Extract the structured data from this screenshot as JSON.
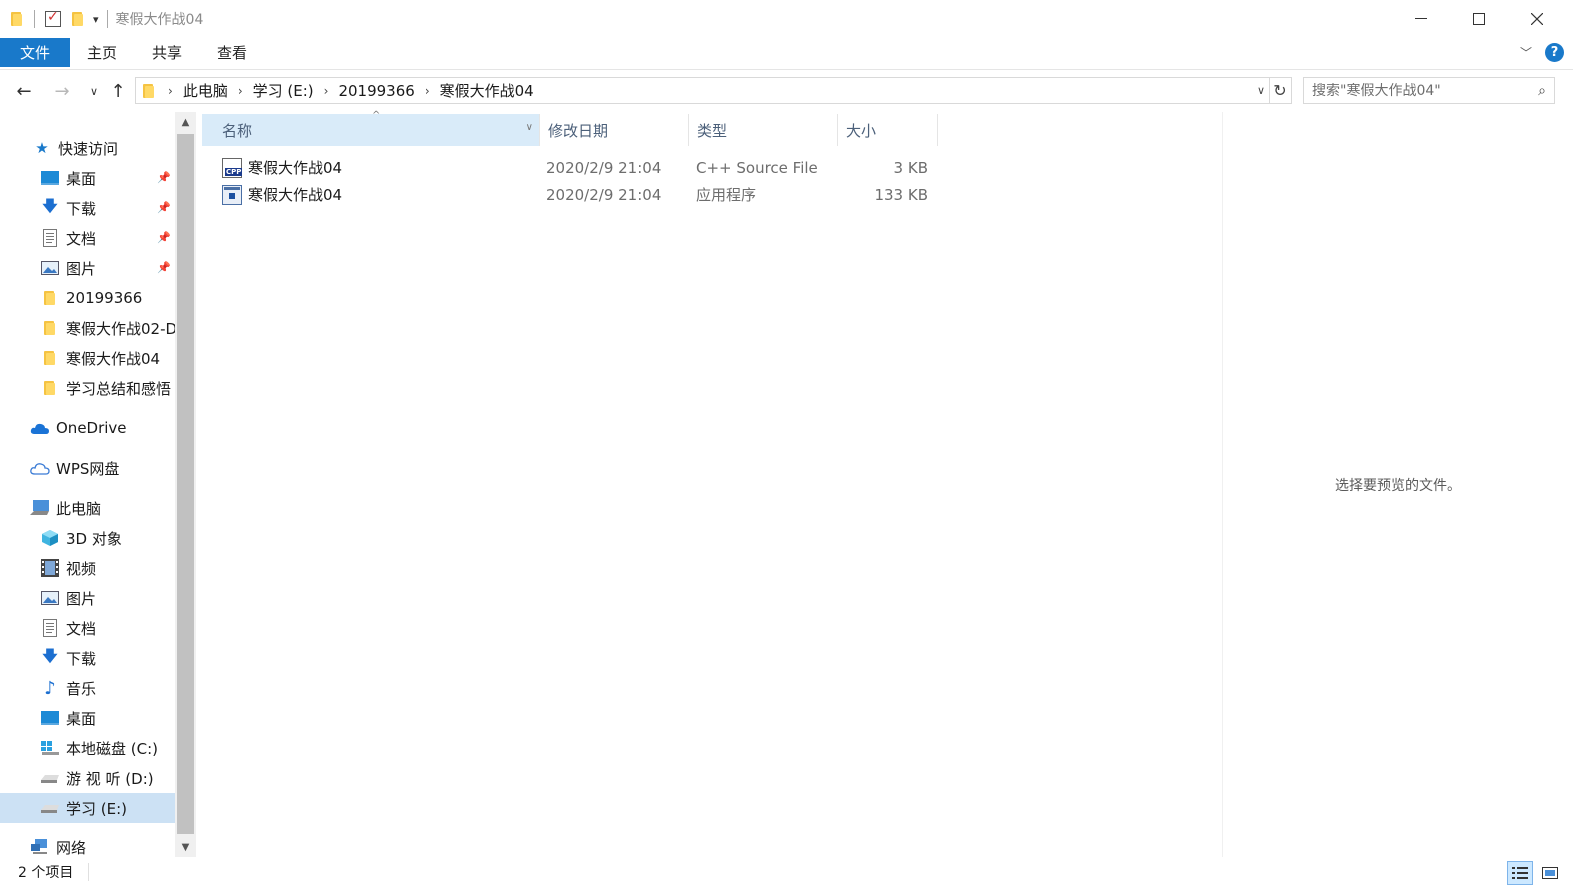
{
  "window": {
    "title": "寒假大作战04",
    "minimize_icon": "minimize-icon",
    "maximize_icon": "maximize-icon",
    "close_icon": "close-icon"
  },
  "ribbon": {
    "tabs": [
      {
        "label": "文件",
        "active": true
      },
      {
        "label": "主页"
      },
      {
        "label": "共享"
      },
      {
        "label": "查看"
      }
    ],
    "accent": "#1979ca"
  },
  "address": {
    "breadcrumbs": [
      "此电脑",
      "学习 (E:)",
      "20199366",
      "寒假大作战04"
    ]
  },
  "search": {
    "placeholder": "搜索\"寒假大作战04\""
  },
  "nav_pane": {
    "quick_access": "快速访问",
    "quick_items": [
      {
        "label": "桌面",
        "icon": "desktop-icon",
        "pinned": true
      },
      {
        "label": "下载",
        "icon": "download-icon",
        "pinned": true
      },
      {
        "label": "文档",
        "icon": "document-icon",
        "pinned": true
      },
      {
        "label": "图片",
        "icon": "pictures-icon",
        "pinned": true
      },
      {
        "label": "20199366",
        "icon": "folder-icon"
      },
      {
        "label": "寒假大作战02-D",
        "icon": "folder-icon"
      },
      {
        "label": "寒假大作战04",
        "icon": "folder-icon"
      },
      {
        "label": "学习总结和感悟",
        "icon": "folder-icon"
      }
    ],
    "onedrive": "OneDrive",
    "wps": "WPS网盘",
    "this_pc": "此电脑",
    "pc_items": [
      {
        "label": "3D 对象",
        "icon": "3d-objects-icon"
      },
      {
        "label": "视频",
        "icon": "video-icon"
      },
      {
        "label": "图片",
        "icon": "pictures-icon"
      },
      {
        "label": "文档",
        "icon": "document-icon"
      },
      {
        "label": "下载",
        "icon": "download-icon"
      },
      {
        "label": "音乐",
        "icon": "music-icon"
      },
      {
        "label": "桌面",
        "icon": "desktop-icon"
      },
      {
        "label": "本地磁盘 (C:)",
        "icon": "windows-drive-icon"
      },
      {
        "label": "游 视 听 (D:)",
        "icon": "drive-icon"
      },
      {
        "label": "学习 (E:)",
        "icon": "drive-icon",
        "selected": true
      }
    ],
    "network": "网络"
  },
  "columns": {
    "name": "名称",
    "modified": "修改日期",
    "type": "类型",
    "size": "大小"
  },
  "files": [
    {
      "name": "寒假大作战04",
      "modified": "2020/2/9 21:04",
      "type": "C++ Source File",
      "size": "3 KB",
      "icon": "cpp-file-icon"
    },
    {
      "name": "寒假大作战04",
      "modified": "2020/2/9 21:04",
      "type": "应用程序",
      "size": "133 KB",
      "icon": "exe-file-icon"
    }
  ],
  "preview": {
    "message": "选择要预览的文件。"
  },
  "status": {
    "item_count": "2 个项目"
  }
}
